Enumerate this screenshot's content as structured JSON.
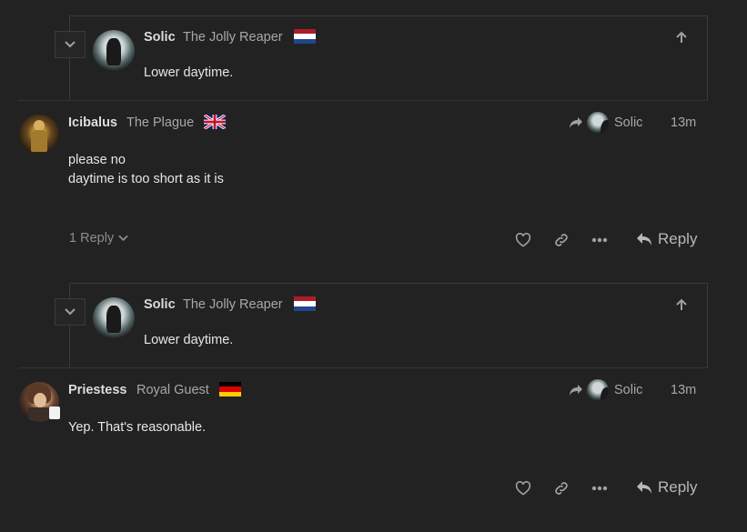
{
  "posts": [
    {
      "type": "quote",
      "author": "Solic",
      "user_title": "The Jolly Reaper",
      "flag": "netherlands-flag",
      "body": "Lower daytime."
    },
    {
      "type": "post",
      "author": "Icibalus",
      "user_title": "The Plague",
      "flag": "uk-flag",
      "reply_to": "Solic",
      "time": "13m",
      "body_lines": [
        "please no",
        "daytime is too short as it is"
      ],
      "replies_label": "1 Reply",
      "reply_label": "Reply"
    },
    {
      "type": "quote",
      "author": "Solic",
      "user_title": "The Jolly Reaper",
      "flag": "netherlands-flag",
      "body": "Lower daytime."
    },
    {
      "type": "post",
      "author": "Priestess",
      "user_title": "Royal Guest",
      "flag": "germany-flag",
      "reply_to": "Solic",
      "time": "13m",
      "body_lines": [
        "Yep. That's reasonable."
      ],
      "reply_label": "Reply"
    }
  ],
  "colors": {
    "background": "#222222",
    "border": "#3a3a3a",
    "text": "#dddddd",
    "muted": "#a8a8a8"
  }
}
